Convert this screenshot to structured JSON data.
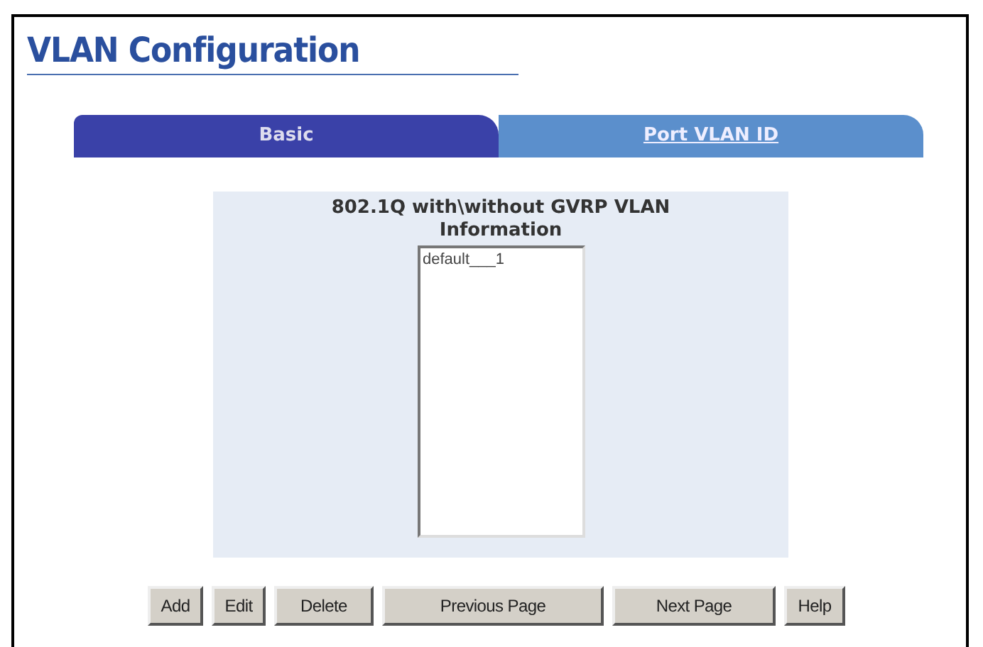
{
  "title": "VLAN Configuration",
  "tabs": [
    {
      "label": "Basic",
      "selected": true
    },
    {
      "label": "Port VLAN ID",
      "selected": false
    }
  ],
  "panel": {
    "heading": "802.1Q with\\without GVRP VLAN Information",
    "list_items": [
      "default___1"
    ]
  },
  "buttons": [
    "Add",
    "Edit",
    "Delete",
    "Previous Page",
    "Next Page",
    "Help"
  ]
}
